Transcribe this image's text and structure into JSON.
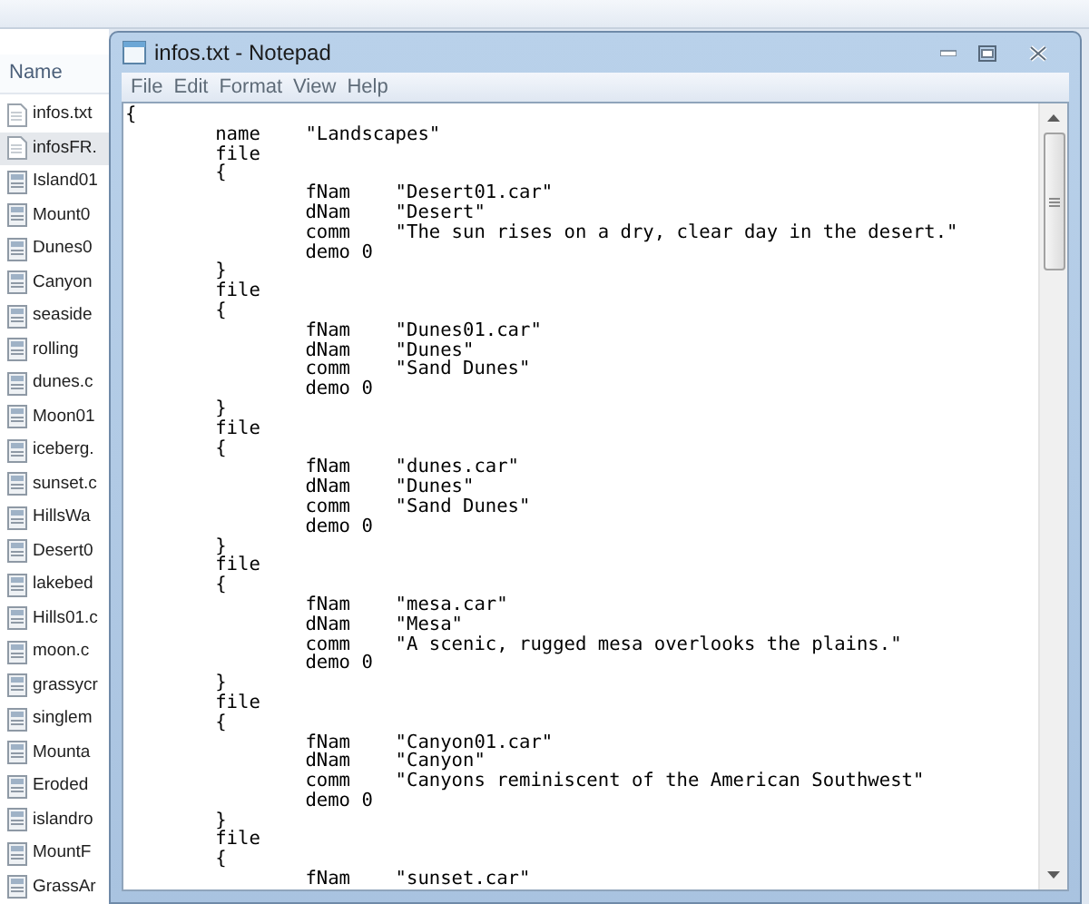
{
  "explorer": {
    "column_header": "Name",
    "files": [
      {
        "name": "infos.txt",
        "kind": "text",
        "selected": false
      },
      {
        "name": "infosFR.",
        "kind": "text",
        "selected": true
      },
      {
        "name": "Island01",
        "kind": "doc",
        "selected": false
      },
      {
        "name": "Mount0",
        "kind": "doc",
        "selected": false
      },
      {
        "name": "Dunes0",
        "kind": "doc",
        "selected": false
      },
      {
        "name": "Canyon",
        "kind": "doc",
        "selected": false
      },
      {
        "name": "seaside",
        "kind": "doc",
        "selected": false
      },
      {
        "name": "rolling",
        "kind": "doc",
        "selected": false
      },
      {
        "name": "dunes.c",
        "kind": "doc",
        "selected": false
      },
      {
        "name": "Moon01",
        "kind": "doc",
        "selected": false
      },
      {
        "name": "iceberg.",
        "kind": "doc",
        "selected": false
      },
      {
        "name": "sunset.c",
        "kind": "doc",
        "selected": false
      },
      {
        "name": "HillsWa",
        "kind": "doc",
        "selected": false
      },
      {
        "name": "Desert0",
        "kind": "doc",
        "selected": false
      },
      {
        "name": "lakebed",
        "kind": "doc",
        "selected": false
      },
      {
        "name": "Hills01.c",
        "kind": "doc",
        "selected": false
      },
      {
        "name": "moon.c",
        "kind": "doc",
        "selected": false
      },
      {
        "name": "grassycr",
        "kind": "doc",
        "selected": false
      },
      {
        "name": "singlem",
        "kind": "doc",
        "selected": false
      },
      {
        "name": "Mounta",
        "kind": "doc",
        "selected": false
      },
      {
        "name": "Eroded",
        "kind": "doc",
        "selected": false
      },
      {
        "name": "islandro",
        "kind": "doc",
        "selected": false
      },
      {
        "name": "MountF",
        "kind": "doc",
        "selected": false
      },
      {
        "name": "GrassAr",
        "kind": "doc",
        "selected": false
      }
    ]
  },
  "window": {
    "title": "infos.txt - Notepad"
  },
  "menu": [
    "File",
    "Edit",
    "Format",
    "View",
    "Help"
  ],
  "lines": [
    "{",
    "\tname\t\"Landscapes\"",
    "\tfile",
    "\t{",
    "\t\tfNam\t\"Desert01.car\"",
    "\t\tdNam\t\"Desert\"",
    "\t\tcomm\t\"The sun rises on a dry, clear day in the desert.\"",
    "\t\tdemo 0",
    "\t}",
    "\tfile",
    "\t{",
    "\t\tfNam\t\"Dunes01.car\"",
    "\t\tdNam\t\"Dunes\"",
    "\t\tcomm\t\"Sand Dunes\"",
    "\t\tdemo 0",
    "\t}",
    "\tfile",
    "\t{",
    "\t\tfNam\t\"dunes.car\"",
    "\t\tdNam\t\"Dunes\"",
    "\t\tcomm\t\"Sand Dunes\"",
    "\t\tdemo 0",
    "\t}",
    "\tfile",
    "\t{",
    "\t\tfNam\t\"mesa.car\"",
    "\t\tdNam\t\"Mesa\"",
    "\t\tcomm\t\"A scenic, rugged mesa overlooks the plains.\"",
    "\t\tdemo 0",
    "\t}",
    "\tfile",
    "\t{",
    "\t\tfNam\t\"Canyon01.car\"",
    "\t\tdNam\t\"Canyon\"",
    "\t\tcomm\t\"Canyons reminiscent of the American Southwest\"",
    "\t\tdemo 0",
    "\t}",
    "\tfile",
    "\t{",
    "\t\tfNam\t\"sunset.car\""
  ]
}
